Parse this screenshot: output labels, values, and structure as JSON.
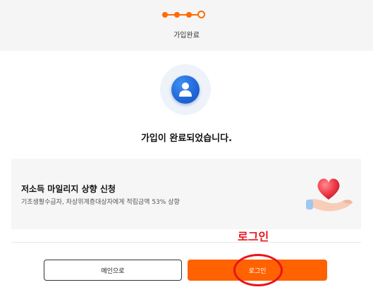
{
  "header": {
    "title": "가입완료",
    "progress": {
      "total_steps": 4,
      "current_step": 4
    },
    "accent_color": "#ff6a00"
  },
  "main": {
    "avatar_icon": "user-icon",
    "message": "가입이 완료되었습니다."
  },
  "promo": {
    "title": "저소득 마일리지 상향 신청",
    "description": "기초생활수급자, 차상위계층대상자에게 적립금액 53% 상향",
    "image_icon": "heart-in-hand-icon"
  },
  "annotation": {
    "label": "로그인",
    "color": "#e8141c"
  },
  "buttons": {
    "main_label": "메인으로",
    "login_label": "로그인",
    "login_color": "#ff6200"
  }
}
